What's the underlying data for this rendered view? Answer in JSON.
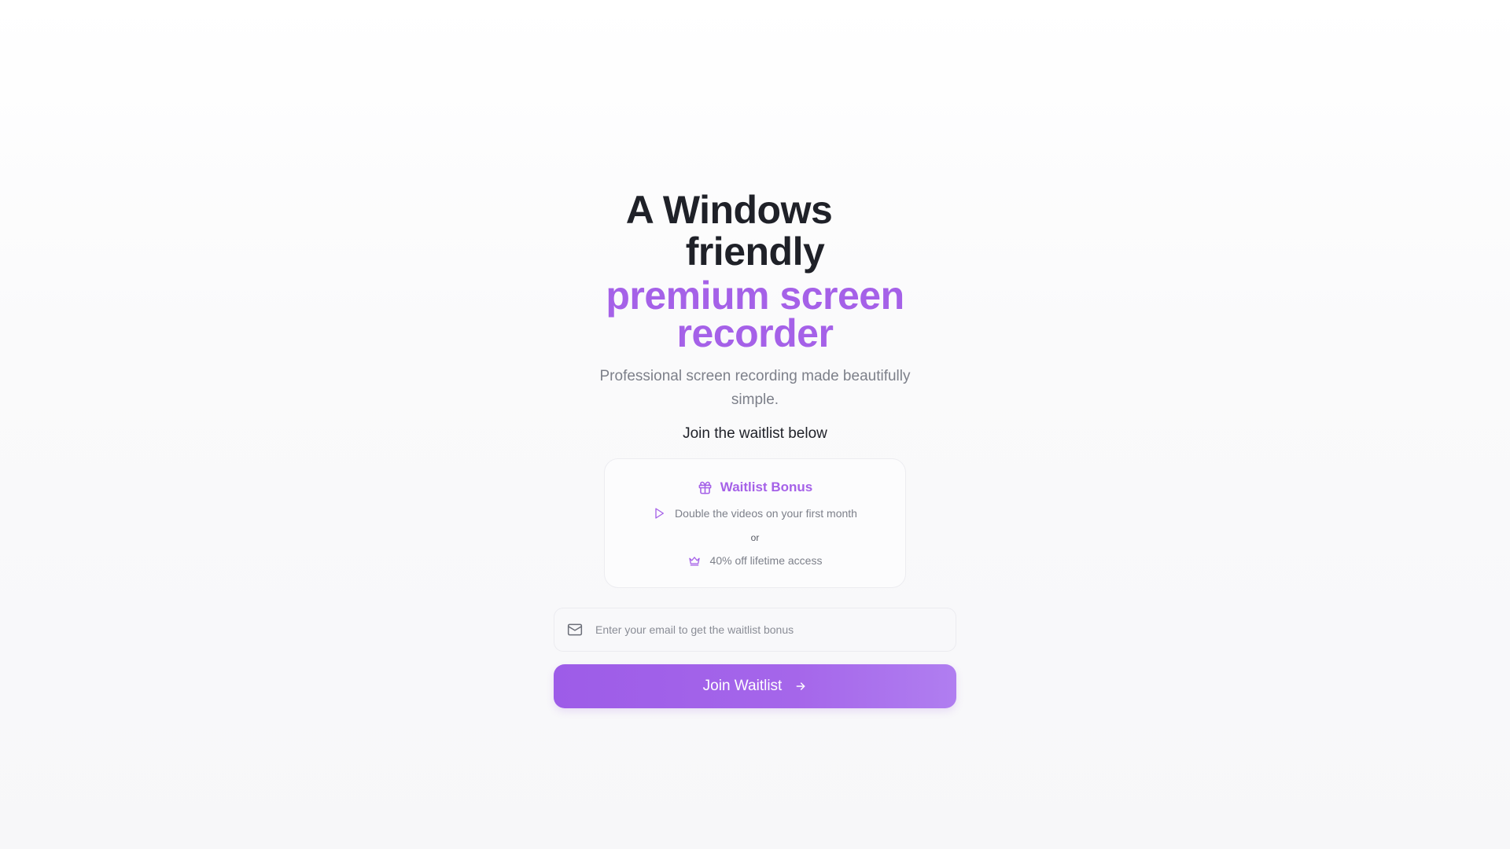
{
  "hero": {
    "title_line1": "A Windows",
    "title_line2": "friendly",
    "title_accent_line1": "premium screen",
    "title_accent_line2": "recorder",
    "subtitle_line1": "Professional screen recording made beautifully",
    "subtitle_line2": "simple.",
    "join_text": "Join the waitlist below"
  },
  "bonus": {
    "title": "Waitlist Bonus",
    "title_icon": "gift-icon",
    "option1_icon": "play-icon",
    "option1": "Double the videos on your first month",
    "separator": "or",
    "option2_icon": "crown-icon",
    "option2": "40% off lifetime access"
  },
  "form": {
    "email_icon": "mail-icon",
    "email_placeholder": "Enter your email to get the waitlist bonus",
    "email_value": "",
    "button_label": "Join Waitlist",
    "button_icon": "arrow-right-icon"
  },
  "colors": {
    "accent": "#a561e8",
    "heading": "#1f2128",
    "muted": "#7d808a"
  }
}
